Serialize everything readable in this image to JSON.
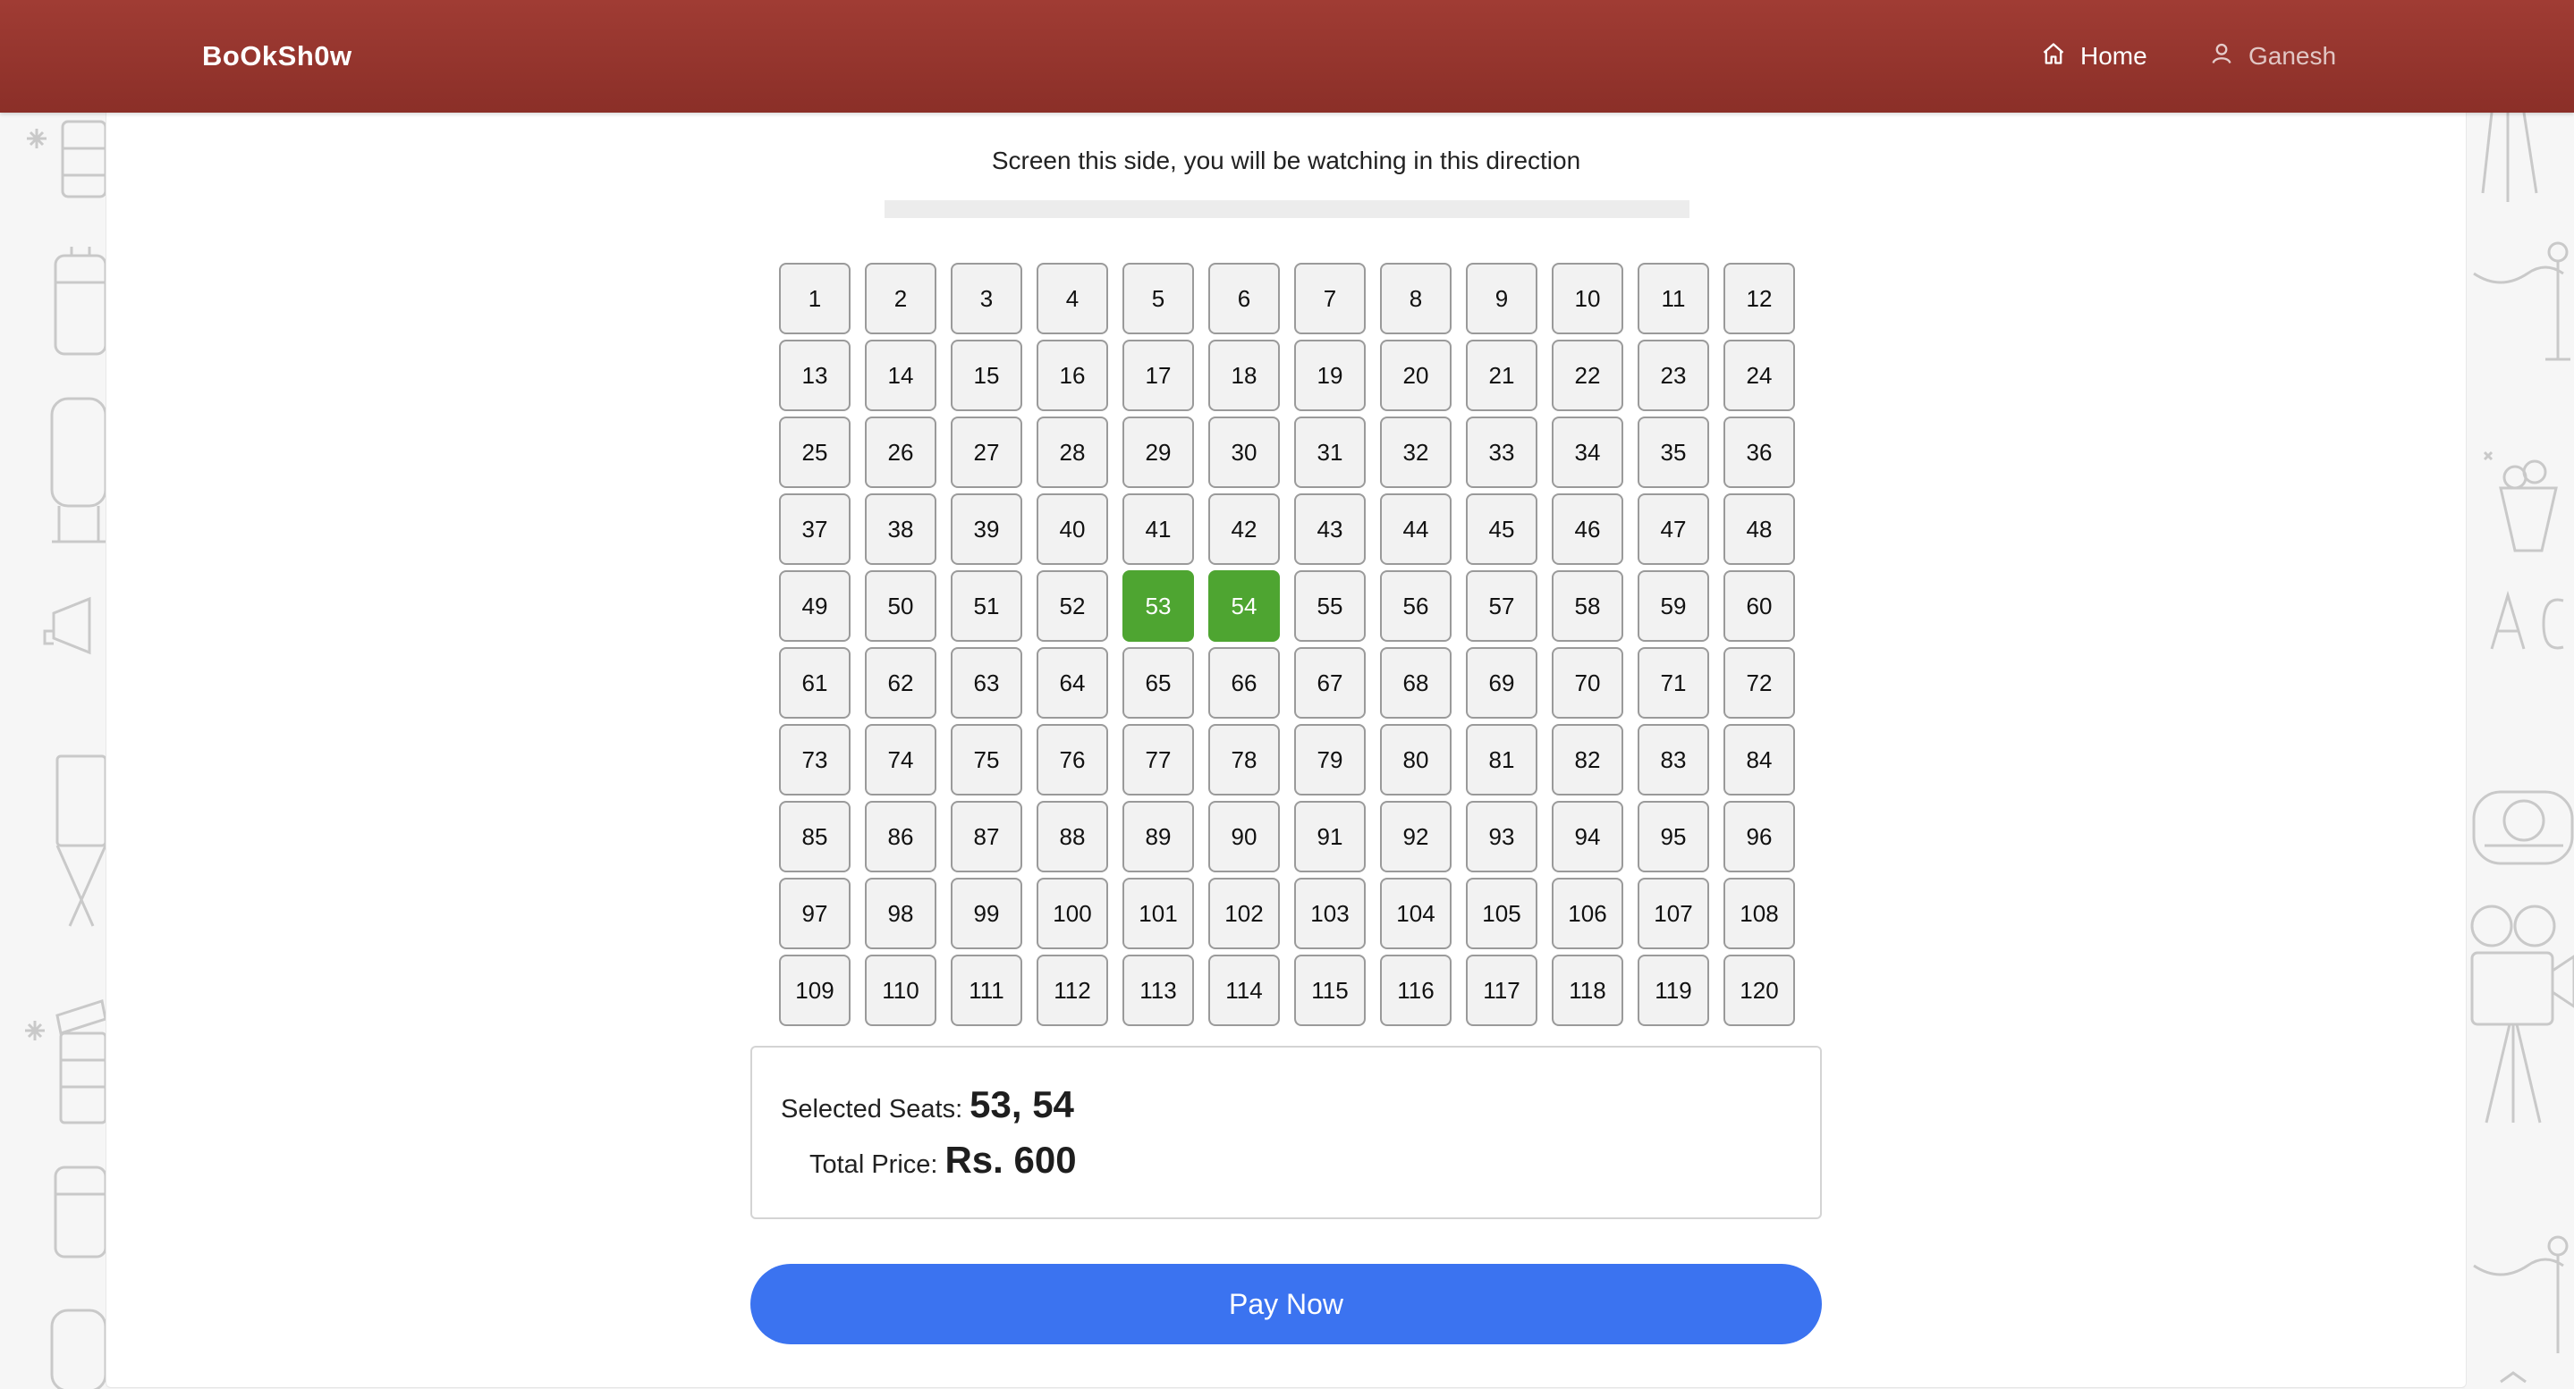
{
  "navbar": {
    "brand": "BoOkSh0w",
    "home_label": "Home",
    "user_label": "Ganesh"
  },
  "screen": {
    "caption": "Screen this side, you will be watching in this direction"
  },
  "seats": {
    "labels": [
      "1",
      "2",
      "3",
      "4",
      "5",
      "6",
      "7",
      "8",
      "9",
      "10",
      "11",
      "12",
      "13",
      "14",
      "15",
      "16",
      "17",
      "18",
      "19",
      "20",
      "21",
      "22",
      "23",
      "24",
      "25",
      "26",
      "27",
      "28",
      "29",
      "30",
      "31",
      "32",
      "33",
      "34",
      "35",
      "36",
      "37",
      "38",
      "39",
      "40",
      "41",
      "42",
      "43",
      "44",
      "45",
      "46",
      "47",
      "48",
      "49",
      "50",
      "51",
      "52",
      "53",
      "54",
      "55",
      "56",
      "57",
      "58",
      "59",
      "60",
      "61",
      "62",
      "63",
      "64",
      "65",
      "66",
      "67",
      "68",
      "69",
      "70",
      "71",
      "72",
      "73",
      "74",
      "75",
      "76",
      "77",
      "78",
      "79",
      "80",
      "81",
      "82",
      "83",
      "84",
      "85",
      "86",
      "87",
      "88",
      "89",
      "90",
      "91",
      "92",
      "93",
      "94",
      "95",
      "96",
      "97",
      "98",
      "99",
      "100",
      "101",
      "102",
      "103",
      "104",
      "105",
      "106",
      "107",
      "108",
      "109",
      "110",
      "111",
      "112",
      "113",
      "114",
      "115",
      "116",
      "117",
      "118",
      "119",
      "120"
    ],
    "selected": [
      "53",
      "54"
    ]
  },
  "summary": {
    "seats_label": "Selected Seats:",
    "seats_value": "53, 54",
    "price_label": "Total Price:",
    "price_value": "Rs. 600"
  },
  "actions": {
    "pay_label": "Pay Now"
  },
  "colors": {
    "navbar": "#952f29",
    "selected_seat": "#4ea531",
    "pay_button": "#3b73f0"
  },
  "icons": {
    "home": "home-icon",
    "user": "user-icon"
  }
}
